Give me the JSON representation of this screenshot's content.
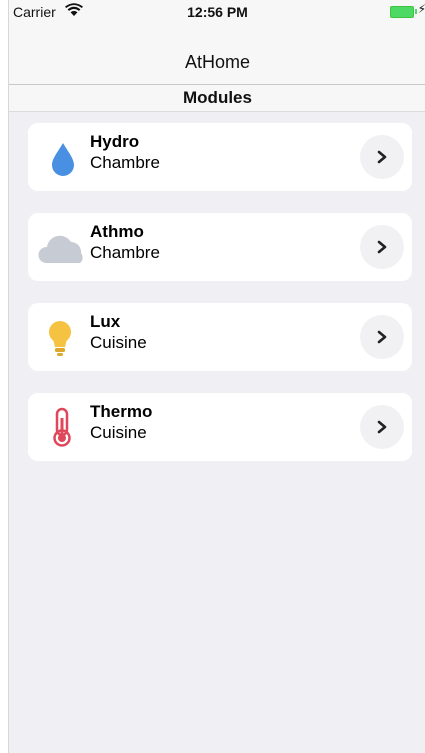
{
  "status_bar": {
    "carrier": "Carrier",
    "time": "12:56 PM",
    "wifi_icon": "wifi-icon",
    "battery_icon": "battery-charging-icon"
  },
  "nav": {
    "title": "AtHome"
  },
  "section": {
    "title": "Modules"
  },
  "modules": [
    {
      "name": "Hydro",
      "room": "Chambre",
      "icon": "water-drop-icon",
      "color": "#4a90e2"
    },
    {
      "name": "Athmo",
      "room": "Chambre",
      "icon": "cloud-icon",
      "color": "#c7ccd4"
    },
    {
      "name": "Lux",
      "room": "Cuisine",
      "icon": "lightbulb-icon",
      "color": "#f5c242"
    },
    {
      "name": "Thermo",
      "room": "Cuisine",
      "icon": "thermometer-icon",
      "color": "#e0475b"
    }
  ]
}
